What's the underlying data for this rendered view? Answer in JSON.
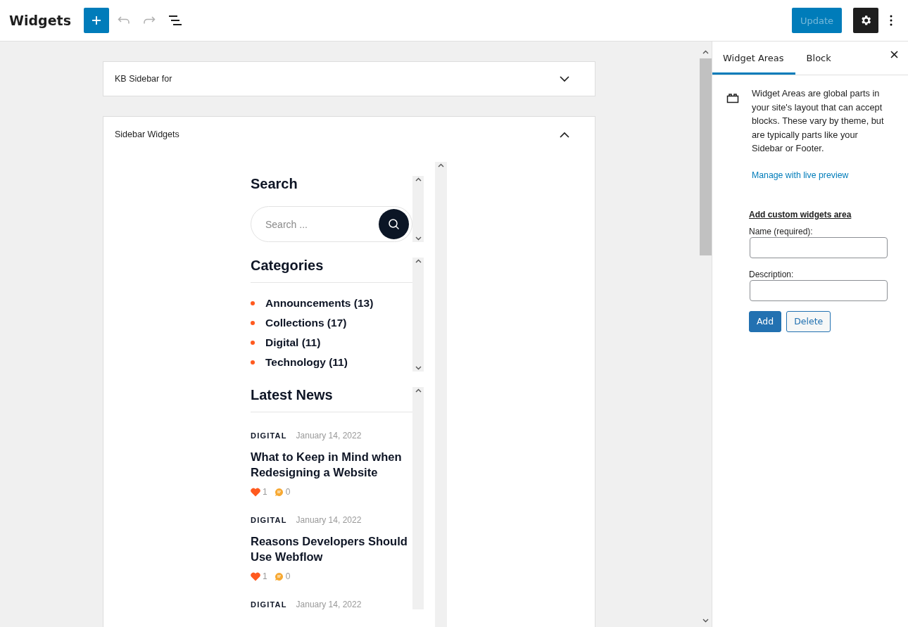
{
  "header": {
    "title": "Widgets",
    "undo_disabled": true,
    "redo_disabled": true,
    "update": {
      "label": "Update",
      "disabled": true
    }
  },
  "panels": [
    {
      "title": "KB Sidebar for",
      "expanded": false
    },
    {
      "title": "Sidebar Widgets",
      "expanded": true
    }
  ],
  "search_widget": {
    "title": "Search",
    "placeholder": "Search ..."
  },
  "categories_widget": {
    "title": "Categories",
    "items": [
      {
        "label": "Announcements (13)"
      },
      {
        "label": "Collections (17)"
      },
      {
        "label": "Digital (11)"
      },
      {
        "label": "Technology (11)"
      }
    ]
  },
  "news_widget": {
    "title": "Latest News",
    "posts": [
      {
        "category": "DIGITAL",
        "date": "January 14, 2022",
        "title": "What to Keep in Mind when Redesigning a Website",
        "likes": "1",
        "comments": "0"
      },
      {
        "category": "DIGITAL",
        "date": "January 14, 2022",
        "title": "Reasons Developers Should Use Webflow",
        "likes": "1",
        "comments": "0"
      },
      {
        "category": "DIGITAL",
        "date": "January 14, 2022"
      }
    ]
  },
  "sidebar": {
    "tabs": [
      {
        "label": "Widget Areas",
        "selected": true
      },
      {
        "label": "Block",
        "selected": false
      }
    ],
    "description": "Widget Areas are global parts in your site's layout that can accept blocks. These vary by theme, but are typically parts like your Sidebar or Footer.",
    "link": "Manage with live preview",
    "form": {
      "heading": "Add custom widgets area",
      "fields": [
        {
          "label": "Name (required):"
        },
        {
          "label": "Description:"
        }
      ],
      "buttons": [
        {
          "label": "Add",
          "kind": "primary"
        },
        {
          "label": "Delete",
          "kind": "secondary"
        }
      ]
    }
  }
}
